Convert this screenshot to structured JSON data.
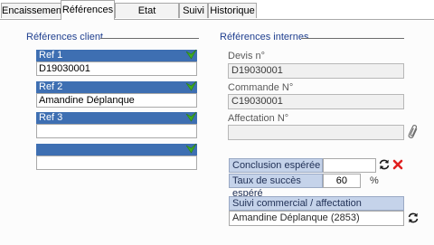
{
  "tabs": [
    {
      "label": "Encaissement",
      "active": false
    },
    {
      "label": "Références",
      "active": true
    },
    {
      "label": "Etat commande",
      "active": false
    },
    {
      "label": "Suivi",
      "active": false
    },
    {
      "label": "Historique",
      "active": false
    }
  ],
  "client": {
    "title": "Références client",
    "refs": [
      {
        "label": "Ref 1",
        "value": "D19030001"
      },
      {
        "label": "Ref 2",
        "value": "Amandine Déplanque"
      },
      {
        "label": "Ref 3",
        "value": ""
      },
      {
        "label": "",
        "value": ""
      }
    ]
  },
  "internal": {
    "title": "Références internes",
    "devis_label": "Devis n°",
    "devis_value": "D19030001",
    "commande_label": "Commande N°",
    "commande_value": "C19030001",
    "affectation_label": "Affectation N°",
    "affectation_value": "",
    "conclusion_label": "Conclusion espérée",
    "conclusion_value": "",
    "taux_label": "Taux de succès espéré",
    "taux_value": "60",
    "taux_unit": "%",
    "suivi_label": "Suivi commercial / affectation",
    "suivi_value": "Amandine Déplanque (2853)"
  },
  "icons": {
    "check": "green-check-arrow-icon",
    "attach": "paperclip-icon",
    "refresh": "refresh-arrows-icon",
    "delete": "red-x-delete-icon"
  },
  "colors": {
    "ref_header_bg": "#3e6fb2",
    "section_title": "#1f3f8f",
    "check_green": "#3fae1e",
    "delete_red": "#e02020",
    "blue_cell_bg": "#c5d3ea"
  }
}
